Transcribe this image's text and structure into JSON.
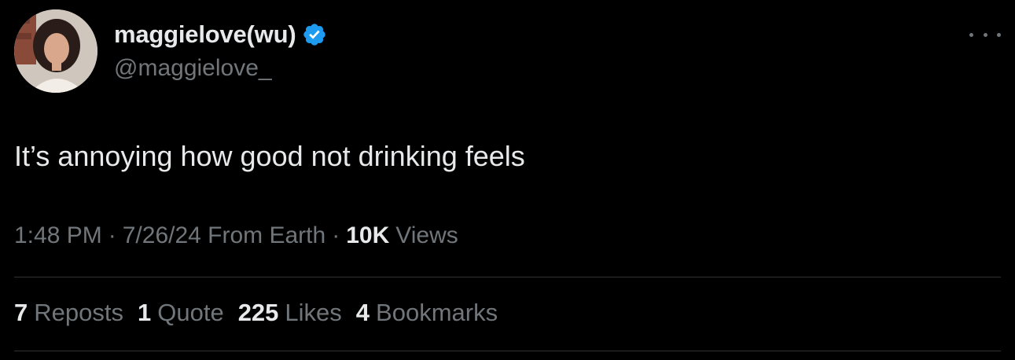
{
  "author": {
    "display_name": "maggielove(wu)",
    "handle": "@maggielove_",
    "verified_icon": "verified-badge-icon",
    "verified_color": "#1d9bf0"
  },
  "tweet": {
    "text": "It’s annoying how good not drinking feels"
  },
  "meta": {
    "time": "1:48 PM",
    "separator": "·",
    "date": "7/26/24 From Earth",
    "views_count": "10K",
    "views_label": "Views"
  },
  "stats": [
    {
      "count": "7",
      "label": "Reposts"
    },
    {
      "count": "1",
      "label": "Quote"
    },
    {
      "count": "225",
      "label": "Likes"
    },
    {
      "count": "4",
      "label": "Bookmarks"
    }
  ],
  "colors": {
    "background": "#000000",
    "primary_text": "#e7e9ea",
    "secondary_text": "#71767b",
    "divider": "#2f3336"
  }
}
